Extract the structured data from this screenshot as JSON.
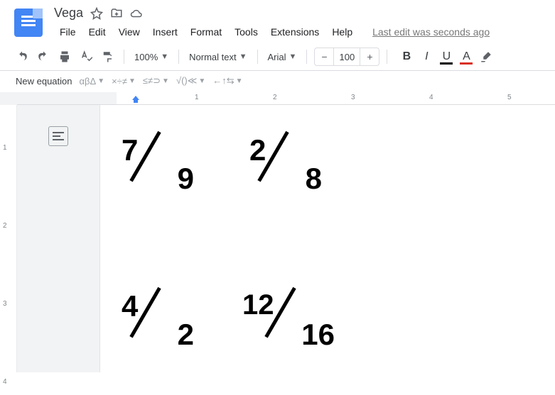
{
  "doc": {
    "title": "Vega",
    "last_edit": "Last edit was seconds ago"
  },
  "menu": {
    "file": "File",
    "edit": "Edit",
    "view": "View",
    "insert": "Insert",
    "format": "Format",
    "tools": "Tools",
    "extensions": "Extensions",
    "help": "Help"
  },
  "toolbar": {
    "zoom": "100%",
    "style": "Normal text",
    "font": "Arial",
    "font_size": "100"
  },
  "eq_toolbar": {
    "new_equation": "New equation",
    "greek": "αβΔ",
    "ops": "×÷≠",
    "rel": "≤≠⊃",
    "root": "√()≪",
    "arrows": "←↑⇆"
  },
  "ruler": {
    "marks": [
      "1",
      "2",
      "3",
      "4",
      "5"
    ]
  },
  "vruler": {
    "marks": [
      "1",
      "2",
      "3",
      "4"
    ]
  },
  "fractions": [
    {
      "num": "7",
      "den": "9"
    },
    {
      "num": "2",
      "den": "8"
    },
    {
      "num": "4",
      "den": "2"
    },
    {
      "num": "12",
      "den": "16"
    }
  ]
}
